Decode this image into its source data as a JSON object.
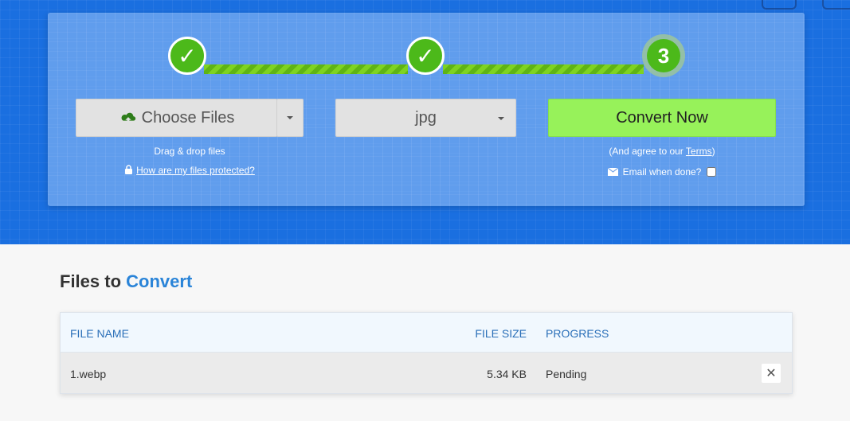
{
  "steps": [
    {
      "state": "done",
      "glyph": "✓"
    },
    {
      "state": "done",
      "glyph": "✓"
    },
    {
      "state": "current",
      "label": "3"
    }
  ],
  "upload": {
    "choose_label": "Choose Files",
    "drag_drop": "Drag & drop files",
    "protected_link": "How are my files protected?"
  },
  "format": {
    "selected": "jpg"
  },
  "convert": {
    "button_label": "Convert Now",
    "agree_prefix": "(And agree to our ",
    "terms_link": "Terms",
    "agree_suffix": ")",
    "email_label": "Email when done?"
  },
  "files_section": {
    "title_part1": "Files to",
    "title_part2": "Convert",
    "columns": {
      "name": "FILE NAME",
      "size": "FILE SIZE",
      "progress": "PROGRESS"
    },
    "rows": [
      {
        "name": "1.webp",
        "size": "5.34 KB",
        "progress": "Pending"
      }
    ]
  },
  "colors": {
    "hero": "#1a6fe0",
    "step_green": "#4cb91a",
    "convert_green": "#97f25a",
    "accent_blue": "#2a84d8"
  }
}
